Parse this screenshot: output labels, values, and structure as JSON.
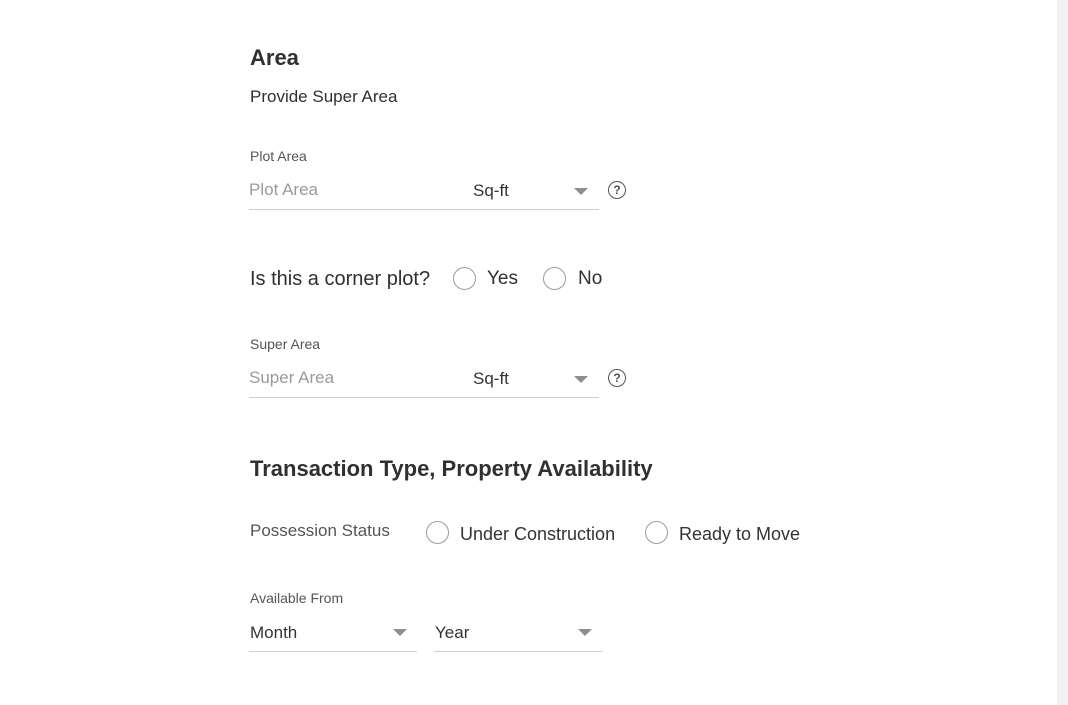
{
  "area": {
    "title": "Area",
    "subtitle": "Provide Super Area",
    "plot_area": {
      "label": "Plot Area",
      "placeholder": "Plot Area",
      "unit": "Sq-ft",
      "help": "?"
    },
    "corner_plot": {
      "question": "Is this a corner plot?",
      "options": [
        "Yes",
        "No"
      ]
    },
    "super_area": {
      "label": "Super Area",
      "placeholder": "Super Area",
      "unit": "Sq-ft",
      "help": "?"
    }
  },
  "transaction": {
    "title": "Transaction Type, Property Availability",
    "possession": {
      "label": "Possession Status",
      "options": [
        "Under Construction",
        "Ready to Move"
      ]
    },
    "available_from": {
      "label": "Available From",
      "month": "Month",
      "year": "Year"
    }
  }
}
